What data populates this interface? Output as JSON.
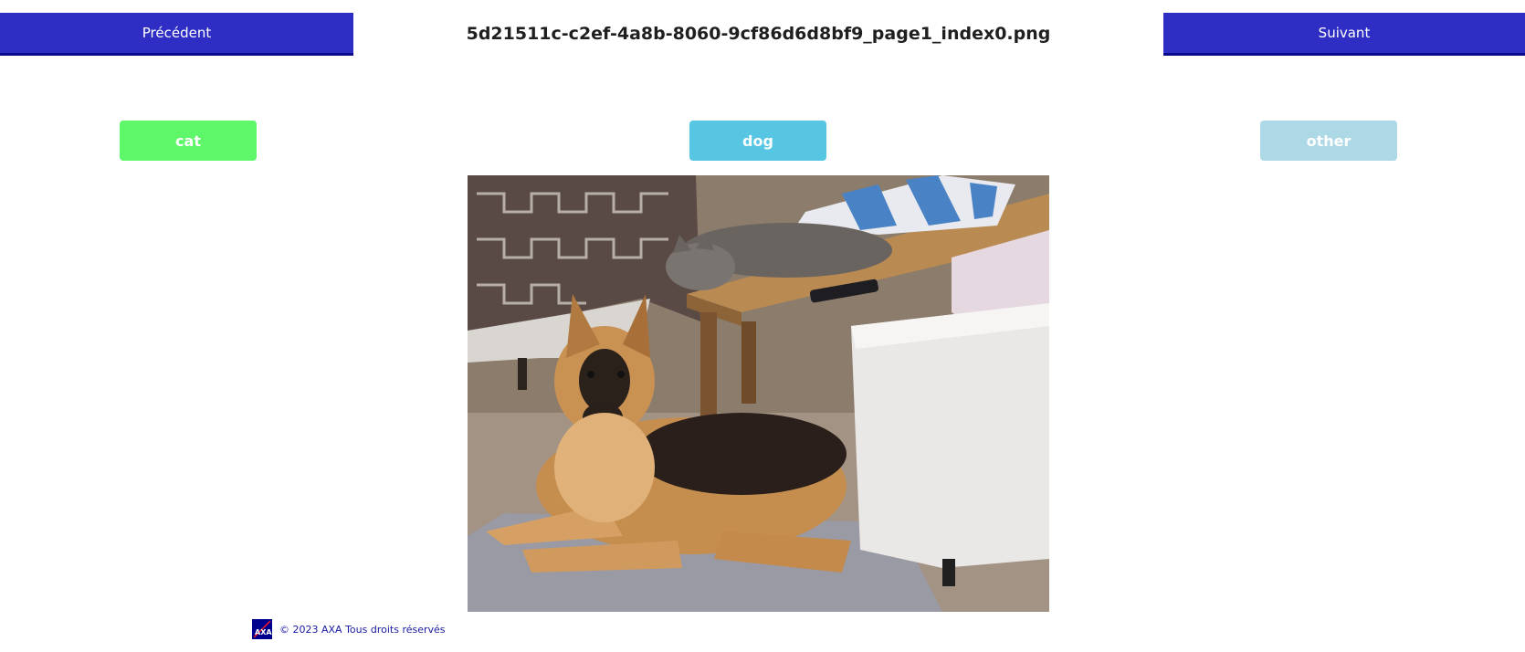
{
  "nav": {
    "prev_label": "Précédent",
    "next_label": "Suivant",
    "filename": "5d21511c-c2ef-4a8b-8060-9cf86d6d8bf9_page1_index0.png"
  },
  "labels": {
    "cat": "cat",
    "dog": "dog",
    "other": "other"
  },
  "colors": {
    "nav_bg": "#2e2ec4",
    "cat": "#5ff76a",
    "dog": "#56c6e3",
    "other": "#add8e6"
  },
  "image": {
    "subject_icon": "photo-dog-and-cat"
  },
  "footer": {
    "copyright": "© 2023 AXA Tous droits réservés",
    "logo_icon": "axa-logo"
  }
}
